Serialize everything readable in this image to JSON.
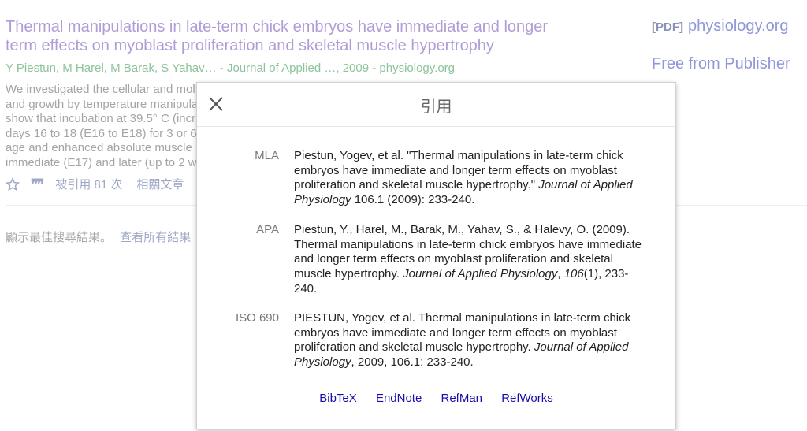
{
  "result": {
    "title_line1": "Thermal manipulations in late-term chick embryos have immediate and longer",
    "title_line2": "term effects on myoblast proliferation and skeletal muscle hypertrophy",
    "authors": "Y Piestun, M Harel, M Barak, S Yahav… - Journal of Applied …, 2009 - physiology.org",
    "snippet_lines": [
      "We investigated the cellular and mol",
      "and growth by temperature manipula",
      "show that incubation at 39.5° C (incr",
      "days 16 to 18 (E16 to E18) for 3 or 6",
      "age and enhanced absolute muscle",
      "immediate (E17) and later (up to 2 w"
    ],
    "cited_by": "被引用 81 次",
    "related": "相關文章"
  },
  "side": {
    "pdf_tag": "[PDF]",
    "pdf_link": "physiology.org",
    "free_link": "Free from Publisher"
  },
  "best_results": {
    "text": "顯示最佳搜尋結果。",
    "link": "查看所有結果"
  },
  "modal": {
    "title": "引用",
    "citations": [
      {
        "label": "MLA",
        "text_html": "Piestun, Yogev, et al. \"Thermal manipulations in late-term chick embryos have immediate and longer term effects on myoblast proliferation and skeletal muscle hypertrophy.\" <i>Journal of Applied Physiology</i> 106.1 (2009): 233-240."
      },
      {
        "label": "APA",
        "text_html": "Piestun, Y., Harel, M., Barak, M., Yahav, S., &amp; Halevy, O. (2009). Thermal manipulations in late-term chick embryos have immediate and longer term effects on myoblast proliferation and skeletal muscle hypertrophy. <i>Journal of Applied Physiology</i>, <i>106</i>(1), 233-240."
      },
      {
        "label": "ISO 690",
        "text_html": "PIESTUN, Yogev, et al. Thermal manipulations in late-term chick embryos have immediate and longer term effects on myoblast proliferation and skeletal muscle hypertrophy. <i>Journal of Applied Physiology</i>, 2009, 106.1: 233-240."
      }
    ],
    "exports": [
      "BibTeX",
      "EndNote",
      "RefMan",
      "RefWorks"
    ]
  },
  "icons": {
    "close": "close-icon",
    "star": "star-icon",
    "quote": "quote-icon"
  },
  "colors": {
    "title_visited": "#b09cd6",
    "authors_green": "#8cc39a",
    "export_link": "#1a0dab",
    "side_link": "#8e97d8"
  }
}
